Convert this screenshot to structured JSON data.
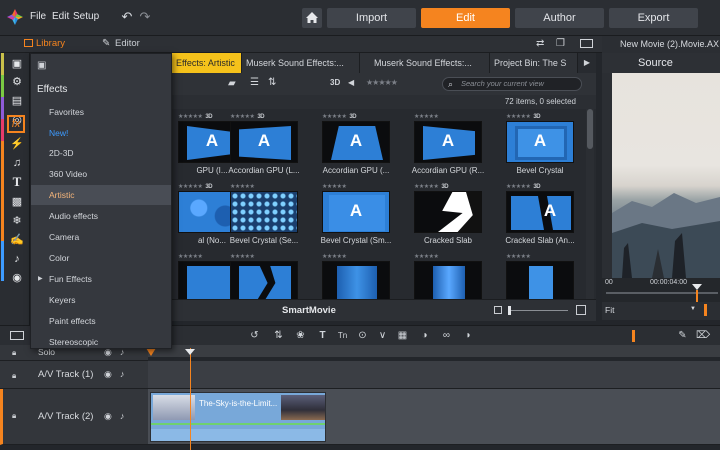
{
  "menubar": {
    "items": [
      "File",
      "Edit",
      "Setup"
    ]
  },
  "modes": {
    "import": "Import",
    "edit": "Edit",
    "author": "Author",
    "export": "Export"
  },
  "subbar": {
    "library": "Library",
    "editor": "Editor"
  },
  "library_tabs": [
    {
      "label": "Effects: Artistic",
      "active": true
    },
    {
      "label": "Muserk Sound Effects:...",
      "active": false
    },
    {
      "label": "Muserk Sound Effects:...",
      "active": false
    },
    {
      "label": "Project Bin: The S",
      "active": false
    }
  ],
  "toolbar": {
    "label_3d": "3D",
    "search_placeholder": "Search your current view",
    "count": "72 items, 0 selected"
  },
  "effects_menu": {
    "title": "Effects",
    "items": [
      {
        "label": "Favorites"
      },
      {
        "label": "New!"
      },
      {
        "label": "2D-3D"
      },
      {
        "label": "360 Video"
      },
      {
        "label": "Artistic"
      },
      {
        "label": "Audio effects"
      },
      {
        "label": "Camera"
      },
      {
        "label": "Color"
      },
      {
        "label": "Fun Effects"
      },
      {
        "label": "Keyers"
      },
      {
        "label": "Paint effects"
      },
      {
        "label": "Stereoscopic"
      }
    ]
  },
  "grid": {
    "row1": [
      {
        "caption": "GPU (I...",
        "label_3d": "3D",
        "letter": "A"
      },
      {
        "caption": "Accordian GPU (L...",
        "label_3d": "3D",
        "letter": "A"
      },
      {
        "caption": "Accordian GPU (...",
        "label_3d": "3D",
        "letter": "A"
      },
      {
        "caption": "Accordian GPU (R...",
        "label_3d": "",
        "letter": "A"
      },
      {
        "caption": "Bevel Crystal",
        "label_3d": "3D",
        "letter": "A"
      }
    ],
    "row2": [
      {
        "caption": "al (No...",
        "label_3d": "3D",
        "letter": ""
      },
      {
        "caption": "Bevel Crystal (Se...",
        "label_3d": "",
        "letter": ""
      },
      {
        "caption": "Bevel Crystal (Sm...",
        "label_3d": "",
        "letter": "A"
      },
      {
        "caption": "Cracked Slab",
        "label_3d": "3D",
        "letter": ""
      },
      {
        "caption": "Cracked Slab (An...",
        "label_3d": "3D",
        "letter": "A"
      }
    ],
    "row3": [
      {
        "caption": "",
        "label_3d": "",
        "letter": ""
      },
      {
        "caption": "",
        "label_3d": "",
        "letter": ""
      },
      {
        "caption": "",
        "label_3d": "",
        "letter": ""
      },
      {
        "caption": "",
        "label_3d": "",
        "letter": ""
      },
      {
        "caption": "",
        "label_3d": "",
        "letter": ""
      }
    ]
  },
  "smartmovie": {
    "label": "SmartMovie"
  },
  "preview": {
    "title": "New Movie (2).Movie.AX",
    "source": "Source",
    "fit": "Fit",
    "time_left": "00",
    "time_right": "00:00:04:00"
  },
  "timeline": {
    "tracks": [
      {
        "name": "Solo"
      },
      {
        "name": "A/V Track (1)"
      },
      {
        "name": "A/V Track (2)"
      }
    ],
    "clip_title": "The-Sky-is-the-Limit..."
  },
  "colors": {
    "accent": "#f5841f",
    "tab_active": "#f5c21b",
    "thumb_blue": "#2d7fd6"
  }
}
